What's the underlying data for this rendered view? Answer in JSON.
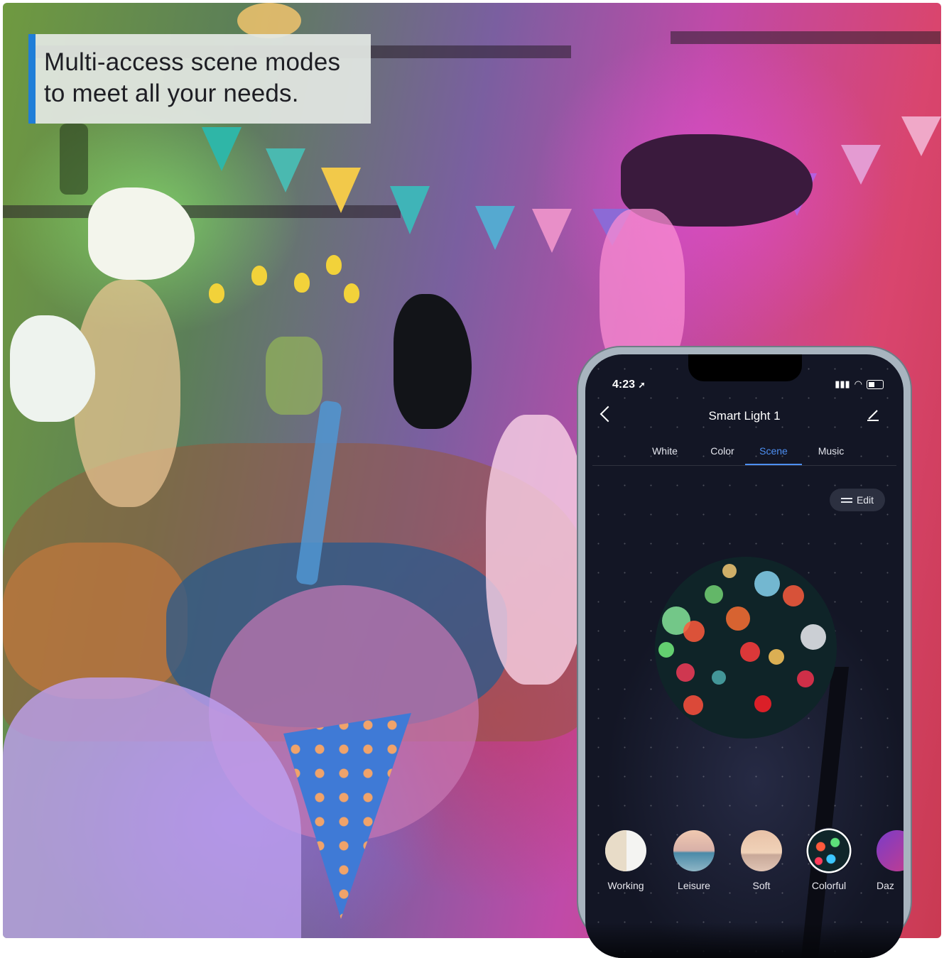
{
  "caption": {
    "line1": "Multi-access  scene modes",
    "line2": "to meet  all your needs."
  },
  "phone": {
    "status": {
      "time": "4:23",
      "location_icon": "location-arrow-icon",
      "signal_icon": "signal-icon",
      "wifi_icon": "wifi-icon",
      "battery_icon": "battery-icon"
    },
    "header": {
      "title": "Smart Light 1",
      "back_icon": "chevron-left-icon",
      "edit_icon": "pencil-icon"
    },
    "tabs": [
      {
        "label": "White"
      },
      {
        "label": "Color"
      },
      {
        "label": "Scene"
      },
      {
        "label": "Music"
      }
    ],
    "active_tab": "Scene",
    "edit_button": {
      "label": "Edit",
      "icon": "sliders-icon"
    },
    "scenes": [
      {
        "label": "Working"
      },
      {
        "label": "Leisure"
      },
      {
        "label": "Soft"
      },
      {
        "label": "Colorful"
      },
      {
        "label": "Daz"
      }
    ],
    "selected_scene": "Colorful",
    "accent_color": "#4d8ff3"
  }
}
